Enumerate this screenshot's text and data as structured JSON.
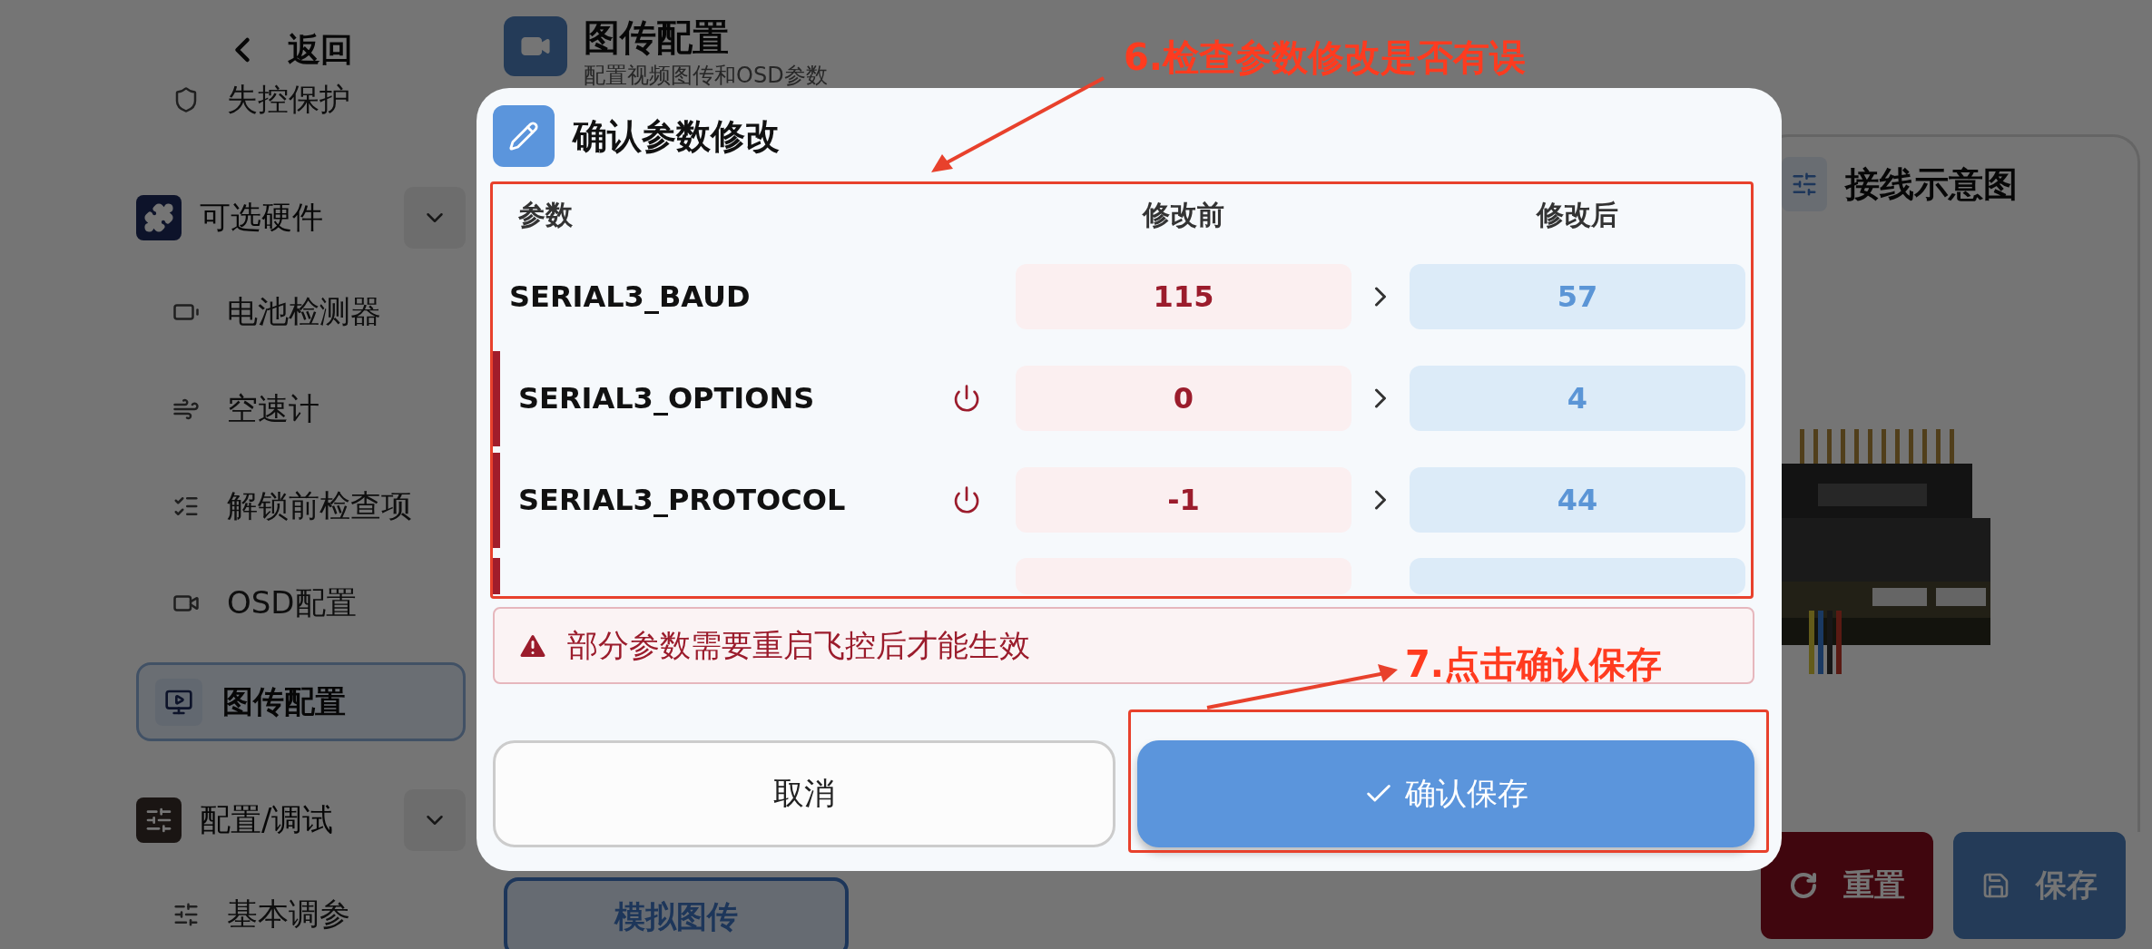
{
  "sidebar": {
    "back": "返回",
    "items": [
      {
        "kind": "item",
        "label": "失控保护",
        "selected": false
      },
      {
        "kind": "group",
        "label": "可选硬件"
      },
      {
        "kind": "item",
        "label": "电池检测器",
        "selected": false
      },
      {
        "kind": "item",
        "label": "空速计",
        "selected": false
      },
      {
        "kind": "item",
        "label": "解锁前检查项",
        "selected": false
      },
      {
        "kind": "item",
        "label": "OSD配置",
        "selected": false
      },
      {
        "kind": "item",
        "label": "图传配置",
        "selected": true
      },
      {
        "kind": "group",
        "label": "配置/调试"
      },
      {
        "kind": "item",
        "label": "基本调参",
        "selected": false
      }
    ]
  },
  "page": {
    "title": "图传配置",
    "subtitle": "配置视频图传和OSD参数",
    "mode_button": "模拟图传"
  },
  "wiring_panel": {
    "title": "接线示意图"
  },
  "actions": [
    {
      "label": "重置",
      "kind": "reset"
    },
    {
      "label": "保存",
      "kind": "save"
    }
  ],
  "dialog": {
    "title": "确认参数修改",
    "columns": [
      "参数",
      "修改前",
      "修改后"
    ],
    "rows": [
      {
        "name": "SERIAL3_BAUD",
        "before": "115",
        "after": "57",
        "needs_reboot": false
      },
      {
        "name": "SERIAL3_OPTIONS",
        "before": "0",
        "after": "4",
        "needs_reboot": true
      },
      {
        "name": "SERIAL3_PROTOCOL",
        "before": "-1",
        "after": "44",
        "needs_reboot": true
      }
    ],
    "warning": "部分参数需要重启飞控后才能生效",
    "buttons": [
      {
        "label": "取消",
        "kind": "secondary"
      },
      {
        "label": "确认保存",
        "kind": "primary"
      }
    ]
  },
  "annotations": [
    {
      "text": "6.检查参数修改是否有误"
    },
    {
      "text": "7.点击确认保存"
    }
  ]
}
